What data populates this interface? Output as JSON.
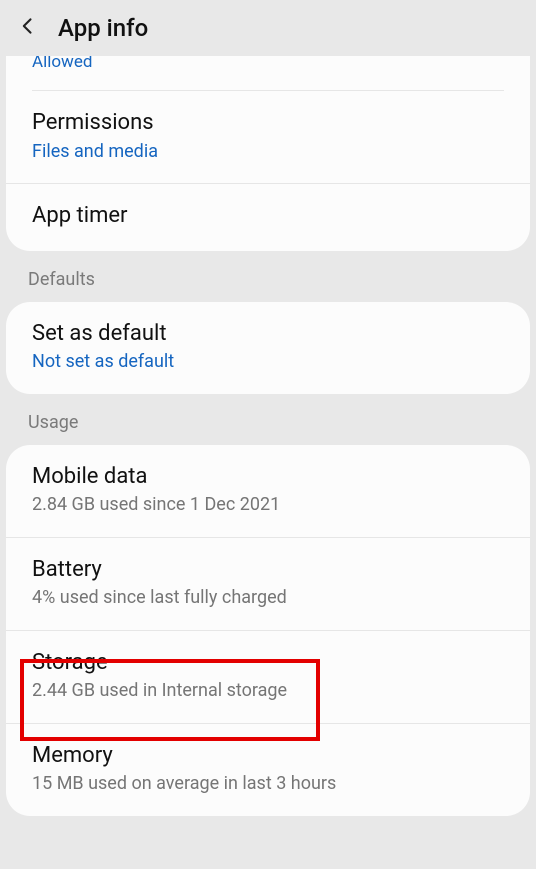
{
  "header": {
    "title": "App info"
  },
  "truncated": {
    "text": "Allowed"
  },
  "card1": {
    "permissions": {
      "title": "Permissions",
      "sub": "Files and media"
    },
    "apptimer": {
      "title": "App timer"
    }
  },
  "sections": {
    "defaults": "Defaults",
    "usage": "Usage"
  },
  "card2": {
    "setdefault": {
      "title": "Set as default",
      "sub": "Not set as default"
    }
  },
  "card3": {
    "mobiledata": {
      "title": "Mobile data",
      "sub": "2.84 GB used since 1 Dec 2021"
    },
    "battery": {
      "title": "Battery",
      "sub": "4% used since last fully charged"
    },
    "storage": {
      "title": "Storage",
      "sub": "2.44 GB used in Internal storage"
    },
    "memory": {
      "title": "Memory",
      "sub": "15 MB used on average in last 3 hours"
    }
  }
}
